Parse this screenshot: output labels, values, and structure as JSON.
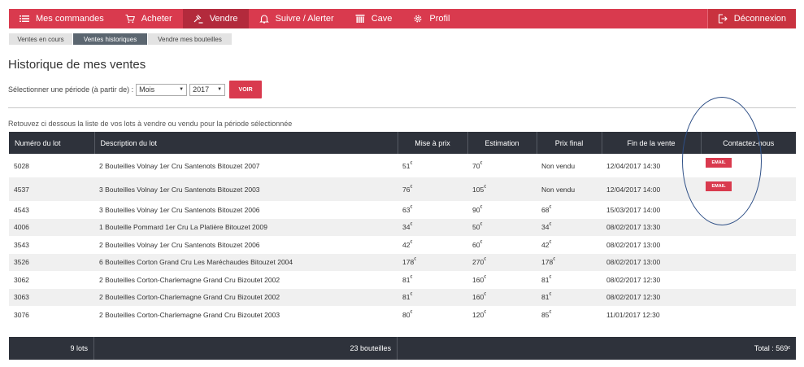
{
  "nav": {
    "items": [
      {
        "label": "Mes commandes",
        "icon": "list-icon"
      },
      {
        "label": "Acheter",
        "icon": "cart-icon"
      },
      {
        "label": "Vendre",
        "icon": "gavel-icon",
        "active": true
      },
      {
        "label": "Suivre / Alerter",
        "icon": "bell-icon"
      },
      {
        "label": "Cave",
        "icon": "cellar-icon"
      },
      {
        "label": "Profil",
        "icon": "gear-icon"
      }
    ],
    "logout": "Déconnexion",
    "accent": "#d93a4e"
  },
  "subnav": [
    "Ventes en cours",
    "Ventes historiques",
    "Vendre mes bouteilles"
  ],
  "page_title": "Historique de mes ventes",
  "period": {
    "label": "Sélectionner une période (à partir de) :",
    "month": "Mois",
    "year": "2017",
    "button": "VOIR"
  },
  "intro": "Retouvez ci dessous la liste de vos lots à vendre ou vendu pour la période sélectionnée",
  "table": {
    "headers": [
      "Numéro du lot",
      "Description du lot",
      "Mise à prix",
      "Estimation",
      "Prix final",
      "Fin de la vente",
      "Contactez-nous"
    ],
    "rows": [
      {
        "lot": "5028",
        "desc": "2 Bouteilles Volnay 1er Cru Santenots Bitouzet 2007",
        "mise": "51",
        "estim": "70",
        "final": "Non vendu",
        "fin": "12/04/2017 14:30",
        "email": "EMAIL"
      },
      {
        "lot": "4537",
        "desc": "3 Bouteilles Volnay 1er Cru Santenots Bitouzet 2003",
        "mise": "76",
        "estim": "105",
        "final": "Non vendu",
        "fin": "12/04/2017 14:00",
        "email": "EMAIL"
      },
      {
        "lot": "4543",
        "desc": "3 Bouteilles Volnay 1er Cru Santenots Bitouzet 2006",
        "mise": "63",
        "estim": "90",
        "final": "68",
        "fin": "15/03/2017 14:00"
      },
      {
        "lot": "4006",
        "desc": "1 Bouteille Pommard 1er Cru La Platière Bitouzet 2009",
        "mise": "34",
        "estim": "50",
        "final": "34",
        "fin": "08/02/2017 13:30"
      },
      {
        "lot": "3543",
        "desc": "2 Bouteilles Volnay 1er Cru Santenots Bitouzet 2006",
        "mise": "42",
        "estim": "60",
        "final": "42",
        "fin": "08/02/2017 13:00"
      },
      {
        "lot": "3526",
        "desc": "6 Bouteilles Corton Grand Cru Les Maréchaudes Bitouzet 2004",
        "mise": "178",
        "estim": "270",
        "final": "178",
        "fin": "08/02/2017 13:00"
      },
      {
        "lot": "3062",
        "desc": "2 Bouteilles Corton-Charlemagne Grand Cru Bizoutet 2002",
        "mise": "81",
        "estim": "160",
        "final": "81",
        "fin": "08/02/2017 12:30"
      },
      {
        "lot": "3063",
        "desc": "2 Bouteilles Corton-Charlemagne Grand Cru Bizoutet 2002",
        "mise": "81",
        "estim": "160",
        "final": "81",
        "fin": "08/02/2017 12:30"
      },
      {
        "lot": "3076",
        "desc": "2 Bouteilles Corton-Charlemagne Grand Cru Bizoutet 2003",
        "mise": "80",
        "estim": "120",
        "final": "85",
        "fin": "11/01/2017 12:30"
      }
    ],
    "currency": "€"
  },
  "footer": {
    "lots": "9 lots",
    "bottles": "23 bouteilles",
    "total": "Total : 569"
  }
}
